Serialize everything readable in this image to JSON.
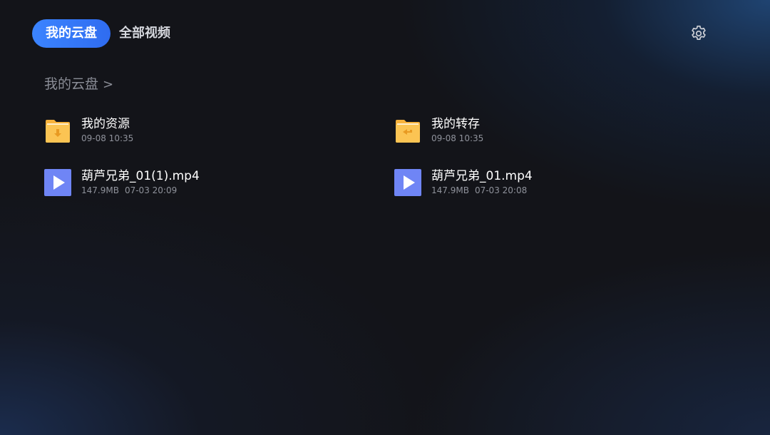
{
  "tabs": [
    {
      "label": "我的云盘",
      "active": true
    },
    {
      "label": "全部视频",
      "active": false
    }
  ],
  "breadcrumb": {
    "label": "我的云盘",
    "separator": ">"
  },
  "settings": {
    "icon": "gear-icon"
  },
  "files": [
    {
      "name": "我的资源",
      "time": "09-08 10:35",
      "size": "",
      "type": "folder",
      "icon": "folder-download-icon"
    },
    {
      "name": "我的转存",
      "time": "09-08 10:35",
      "size": "",
      "type": "folder",
      "icon": "folder-transfer-icon"
    },
    {
      "name": "葫芦兄弟_01(1).mp4",
      "size": "147.9MB",
      "time": "07-03 20:09",
      "type": "video",
      "icon": "video-play-icon"
    },
    {
      "name": "葫芦兄弟_01.mp4",
      "size": "147.9MB",
      "time": "07-03 20:08",
      "type": "video",
      "icon": "video-play-icon"
    }
  ],
  "colors": {
    "accent": "#2f6cf0",
    "folder": "#f7b23b",
    "video": "#6f85f5",
    "background": "#131419"
  }
}
